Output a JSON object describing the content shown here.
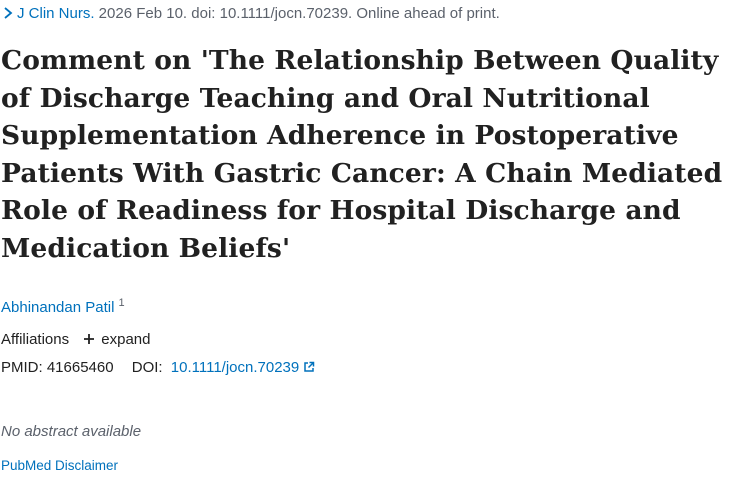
{
  "citation": {
    "journal": "J Clin Nurs.",
    "details": " 2026 Feb 10. doi: 10.1111/jocn.70239. Online ahead of print."
  },
  "article": {
    "title": "Comment on 'The Relationship Between Quality of Discharge Teaching and Oral Nutritional Supplementation Adherence in Postoperative Patients With Gastric Cancer: A Chain Mediated Role of Readiness for Hospital Discharge and Medication Beliefs'"
  },
  "authors": [
    {
      "name": "Abhinandan Patil",
      "affiliation_ref": "1"
    }
  ],
  "affiliations": {
    "label": "Affiliations",
    "expand_label": "expand"
  },
  "identifiers": {
    "pmid_label": "PMID:",
    "pmid": "41665460",
    "doi_label": "DOI:",
    "doi": "10.1111/jocn.70239"
  },
  "abstract": {
    "status": "No abstract available"
  },
  "footer": {
    "disclaimer": "PubMed Disclaimer"
  },
  "colors": {
    "link": "#0071bc",
    "text": "#212121",
    "muted": "#5b616b"
  },
  "icons": {
    "citation_toggle": "chevron-right-icon",
    "expand": "plus-icon",
    "doi": "external-link-icon"
  }
}
